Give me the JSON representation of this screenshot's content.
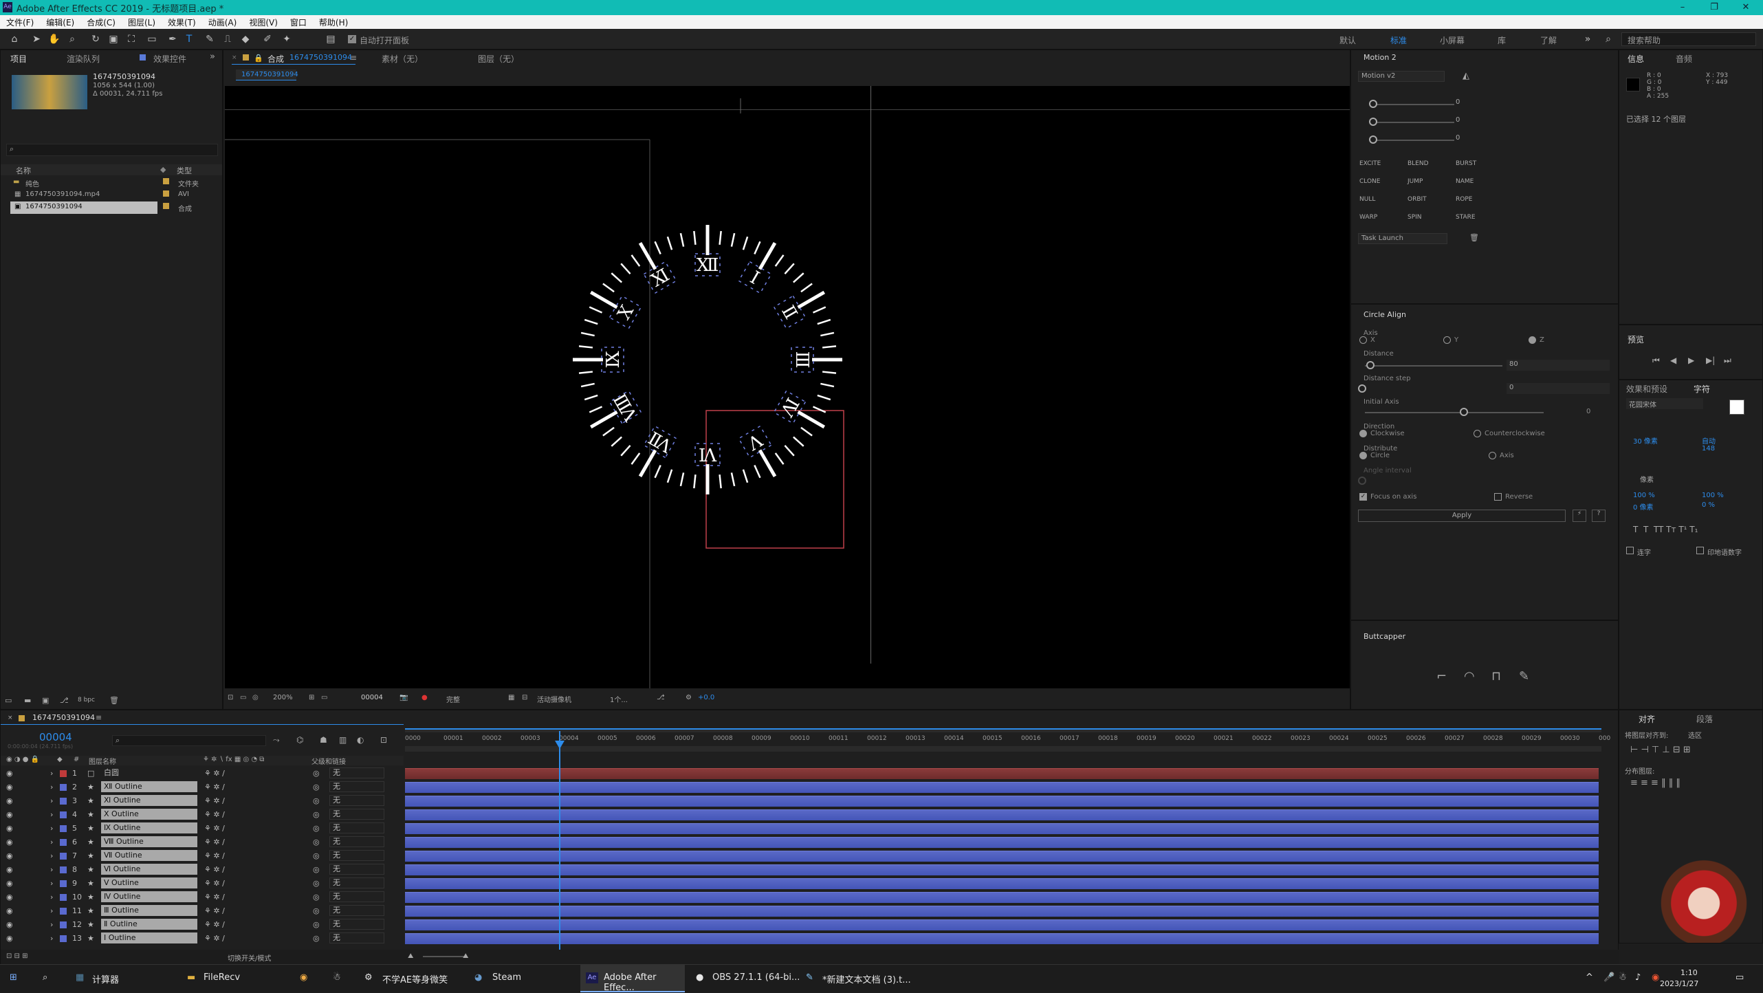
{
  "titlebar": {
    "title": "Adobe After Effects CC 2019 - 无标题项目.aep *",
    "minimize": "–",
    "maximize": "❐",
    "close": "✕"
  },
  "menu": [
    "文件(F)",
    "编辑(E)",
    "合成(C)",
    "图层(L)",
    "效果(T)",
    "动画(A)",
    "视图(V)",
    "窗口",
    "帮助(H)"
  ],
  "toolbar": {
    "auto_open": "自动打开面板",
    "workspaces": [
      "默认",
      "标准",
      "小屏幕",
      "库",
      "了解"
    ],
    "search_placeholder": "搜索帮助"
  },
  "project": {
    "tabs": [
      "项目",
      "渲染队列",
      "效果控件"
    ],
    "selected_name": "1674750391094",
    "meta1": "1056 x 544 (1.00)",
    "meta2": "Δ 00031, 24.711 fps",
    "col_name": "名称",
    "col_type": "类型",
    "items": [
      {
        "name": "纯色",
        "type": "文件夹"
      },
      {
        "name": "1674750391094.mp4",
        "type": "AVI"
      },
      {
        "name": "1674750391094",
        "type": "合成"
      }
    ],
    "bpc": "8 bpc"
  },
  "comp": {
    "tab_label": "合成",
    "tab_name": "1674750391094",
    "footage": "素材（无）",
    "layer": "图层（无）",
    "subtab": "1674750391094",
    "zoom": "200%",
    "frame": "00004",
    "quality": "完整",
    "camera": "活动摄像机",
    "views": "1个...",
    "exposure": "+0.0"
  },
  "motion": {
    "title": "Motion 2",
    "preset": "Motion v2",
    "values": [
      "0",
      "0",
      "0"
    ],
    "buttons": [
      "EXCITE",
      "BLEND",
      "BURST",
      "CLONE",
      "JUMP",
      "NAME",
      "NULL",
      "ORBIT",
      "ROPE",
      "WARP",
      "SPIN",
      "STARE"
    ],
    "task": "Task Launch"
  },
  "circle_align": {
    "title": "Circle Align",
    "axis": "Axis",
    "axes": [
      "X",
      "Y",
      "Z"
    ],
    "distance": "Distance",
    "distance_val": "80",
    "distance_step": "Distance step",
    "step_val": "0",
    "initial_axis": "Initial Axis",
    "initial_val": "0",
    "direction": "Direction",
    "clockwise": "Clockwise",
    "counter": "Counterclockwise",
    "distribute": "Distribute",
    "circle": "Circle",
    "axis_opt": "Axis",
    "angle": "Angle interval",
    "focus": "Focus on axis",
    "reverse": "Reverse",
    "apply": "Apply"
  },
  "buttcapper": {
    "title": "Buttcapper"
  },
  "info": {
    "tabs": [
      "信息",
      "音频"
    ],
    "rgba": [
      "R : 0",
      "G : 0",
      "B : 0",
      "A : 255"
    ],
    "xy": [
      "X : 793",
      "Y : 449"
    ],
    "selected": "已选择 12 个图层"
  },
  "preview": {
    "title": "预览"
  },
  "effects": {
    "tabs": [
      "效果和预设",
      "字符"
    ],
    "font": "花园宋体",
    "size": "30 像素",
    "leading": "自动",
    "tracking": "148",
    "scale_v": "100 %",
    "scale_h": "100 %",
    "baseline": "0 像素",
    "tsume": "0 %",
    "ligature": "连字",
    "hindi": "印地语数字",
    "stroke": "像素"
  },
  "align": {
    "tabs": [
      "对齐",
      "段落"
    ],
    "align_to": "将图层对齐到:",
    "sel": "选区",
    "distribute": "分布图层:"
  },
  "timeline": {
    "tab": "1674750391094",
    "time": "00004",
    "time_sub": "0:00:00:04 (24.711 fps)",
    "col_layer": "图层名称",
    "col_parent": "父级和链接",
    "switch_mode": "切换开关/模式",
    "ticks": [
      "0000",
      "00001",
      "00002",
      "00003",
      "00004",
      "00005",
      "00006",
      "00007",
      "00008",
      "00009",
      "00010",
      "00011",
      "00012",
      "00013",
      "00014",
      "00015",
      "00016",
      "00017",
      "00018",
      "00019",
      "00020",
      "00021",
      "00022",
      "00023",
      "00024",
      "00025",
      "00026",
      "00027",
      "00028",
      "00029",
      "00030",
      "000"
    ],
    "layers": [
      {
        "n": "1",
        "name": "白圆",
        "parent": "无"
      },
      {
        "n": "2",
        "name": "Ⅻ Outline",
        "parent": "无"
      },
      {
        "n": "3",
        "name": "Ⅺ Outline",
        "parent": "无"
      },
      {
        "n": "4",
        "name": "Ⅹ Outline",
        "parent": "无"
      },
      {
        "n": "5",
        "name": "Ⅸ Outline",
        "parent": "无"
      },
      {
        "n": "6",
        "name": "Ⅷ Outline",
        "parent": "无"
      },
      {
        "n": "7",
        "name": "Ⅶ Outline",
        "parent": "无"
      },
      {
        "n": "8",
        "name": "Ⅵ Outline",
        "parent": "无"
      },
      {
        "n": "9",
        "name": "Ⅴ Outline",
        "parent": "无"
      },
      {
        "n": "10",
        "name": "Ⅳ Outline",
        "parent": "无"
      },
      {
        "n": "11",
        "name": "Ⅲ Outline",
        "parent": "无"
      },
      {
        "n": "12",
        "name": "Ⅱ Outline",
        "parent": "无"
      },
      {
        "n": "13",
        "name": "Ⅰ Outline",
        "parent": "无"
      }
    ]
  },
  "numerals": [
    "Ⅻ",
    "Ⅰ",
    "Ⅱ",
    "Ⅲ",
    "Ⅳ",
    "Ⅴ",
    "Ⅵ",
    "Ⅶ",
    "Ⅷ",
    "Ⅸ",
    "Ⅹ",
    "Ⅺ"
  ],
  "taskbar": {
    "items": [
      "计算器",
      "FileRecv",
      "不学AE等身微笑",
      "Steam",
      "Adobe After Effec...",
      "OBS 27.1.1 (64-bi...",
      "*新建文本文档 (3).t..."
    ],
    "time": "1:10",
    "date": "2023/1/27"
  },
  "colors": {
    "accent": "#2d8ceb",
    "titlebar": "#11bcb5",
    "layer_bar": "#4a5ac0",
    "layer_bar_top": "#8a3a3a"
  }
}
